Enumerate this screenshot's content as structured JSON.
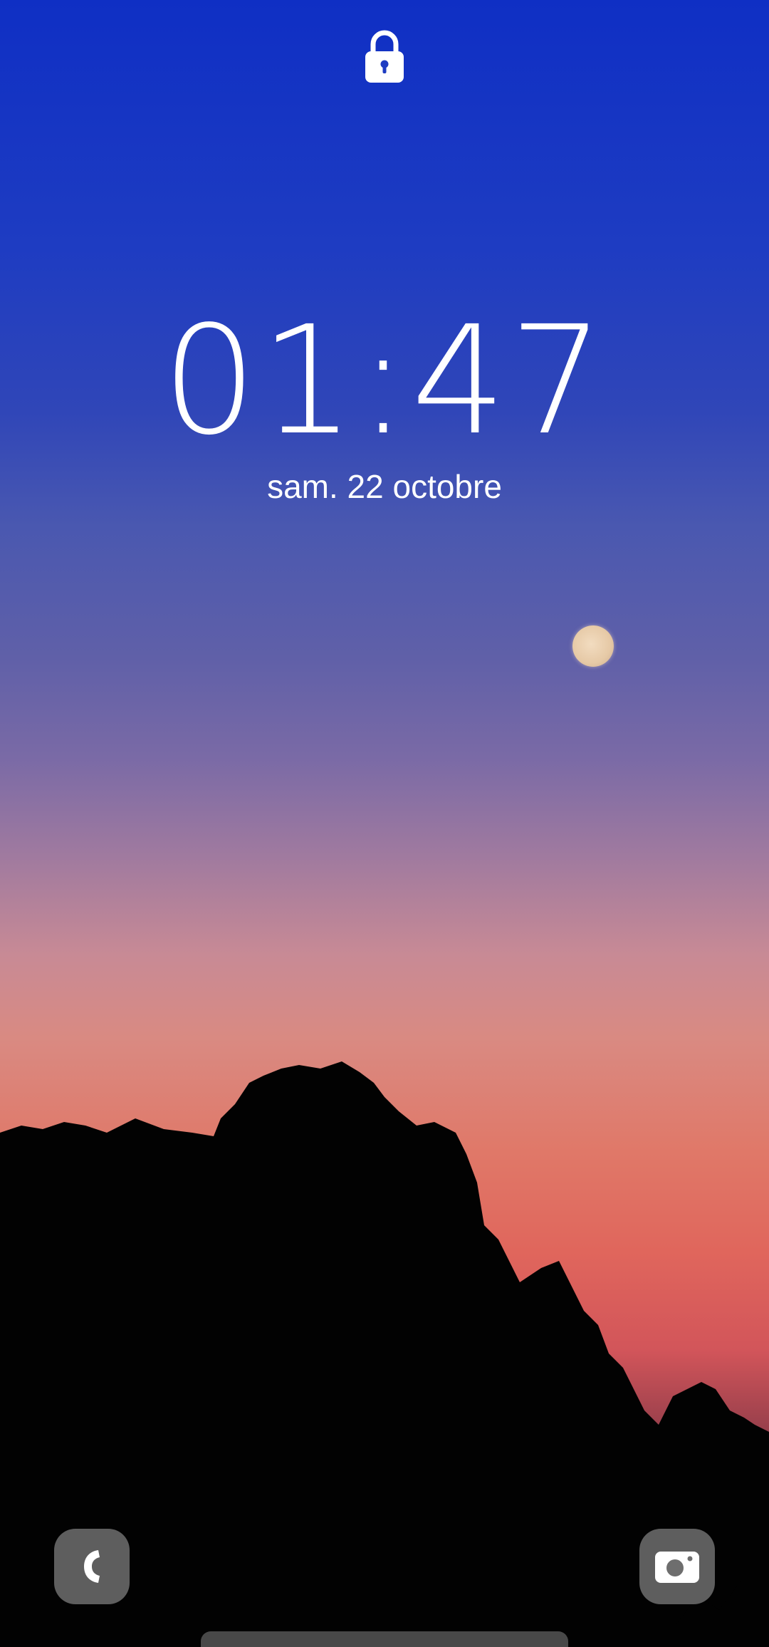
{
  "lockscreen": {
    "time": "01:47",
    "date": "sam. 22 octobre"
  },
  "icons": {
    "lock": "lock-icon",
    "phone": "phone-icon",
    "camera": "camera-icon"
  },
  "colors": {
    "text": "#ffffff",
    "shortcut_bg": "#6e6e6e",
    "sky_top": "#0f2fc4",
    "sky_bottom": "#e0665c"
  }
}
